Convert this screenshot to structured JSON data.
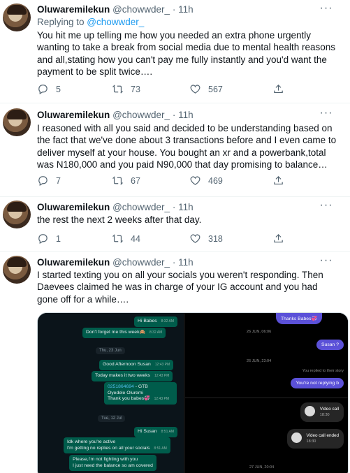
{
  "tweets": [
    {
      "name": "Oluwaremilekun",
      "handle": "@chowwder_",
      "time": "· 11h",
      "replying_prefix": "Replying to ",
      "replying_to": "@chowwder_",
      "text": "You hit me up telling me how you needed an extra phone urgently wanting to take a break from social media due to mental health reasons and all,stating how you can't pay me fully instantly and you'd want the payment to be split twice….",
      "replies": "5",
      "retweets": "73",
      "likes": "567"
    },
    {
      "name": "Oluwaremilekun",
      "handle": "@chowwder_",
      "time": "· 11h",
      "text": "I reasoned with all you said and decided to be understanding based on the fact that we've done about 3 transactions before and I even came to deliver myself at your house. You bought an xr and a powerbank,total was N180,000 and you paid N90,000 that day promising to balance…",
      "replies": "7",
      "retweets": "67",
      "likes": "469"
    },
    {
      "name": "Oluwaremilekun",
      "handle": "@chowwder_",
      "time": "· 11h",
      "text": "the rest the next 2 weeks after that day.",
      "replies": "1",
      "retweets": "44",
      "likes": "318"
    },
    {
      "name": "Oluwaremilekun",
      "handle": "@chowwder_",
      "time": "· 11h",
      "text": "I started texting you on all your socials you weren't responding. Then Daevees claimed he was in charge of your IG account and you had gone off for a while…."
    }
  ],
  "media": {
    "whatsapp": {
      "msg1": "Hi Babes",
      "msg1_time": "8:32 AM",
      "msg2": "Don't forget me this week🙈",
      "msg2_time": "8:32 AM",
      "date1": "Thu, 23 Jun",
      "msg3": "Good Afternoon Susan",
      "msg3_time": "12:43 PM",
      "msg4": "Today makes it two weeks",
      "msg4_time": "12:43 PM",
      "acct_num": "0251864694",
      "acct_bank": " - GTB",
      "acct_name": "Oyedele Oluremi",
      "acct_thanks": "Thank you babes💞",
      "acct_time": "12:43 PM",
      "date2": "Tue, 12 Jul",
      "msg5": "Hi Susan",
      "msg5_time": "8:51 AM",
      "msg6_line1": "Idk where you're active",
      "msg6_line2": "I'm getting no replies on all your socials",
      "msg6_time": "8:51 AM",
      "msg7_line1": "Please,i'm not fighting with you",
      "msg7_line2": "I just need the balance so am covered"
    },
    "instagram": {
      "thanks": "Thanks Babes💞",
      "date1": "26 JUN, 06:06",
      "susan": "Susan ?",
      "date2": "26 JUN, 23:04",
      "replied_story": "You replied to their story",
      "not_replying": "You're not replying b",
      "video_call": "Video call",
      "video_call_time": "18:30",
      "video_call_ended": "Video call ended",
      "video_call_ended_time": "18:30",
      "date3": "27 JUN, 20:04"
    }
  }
}
